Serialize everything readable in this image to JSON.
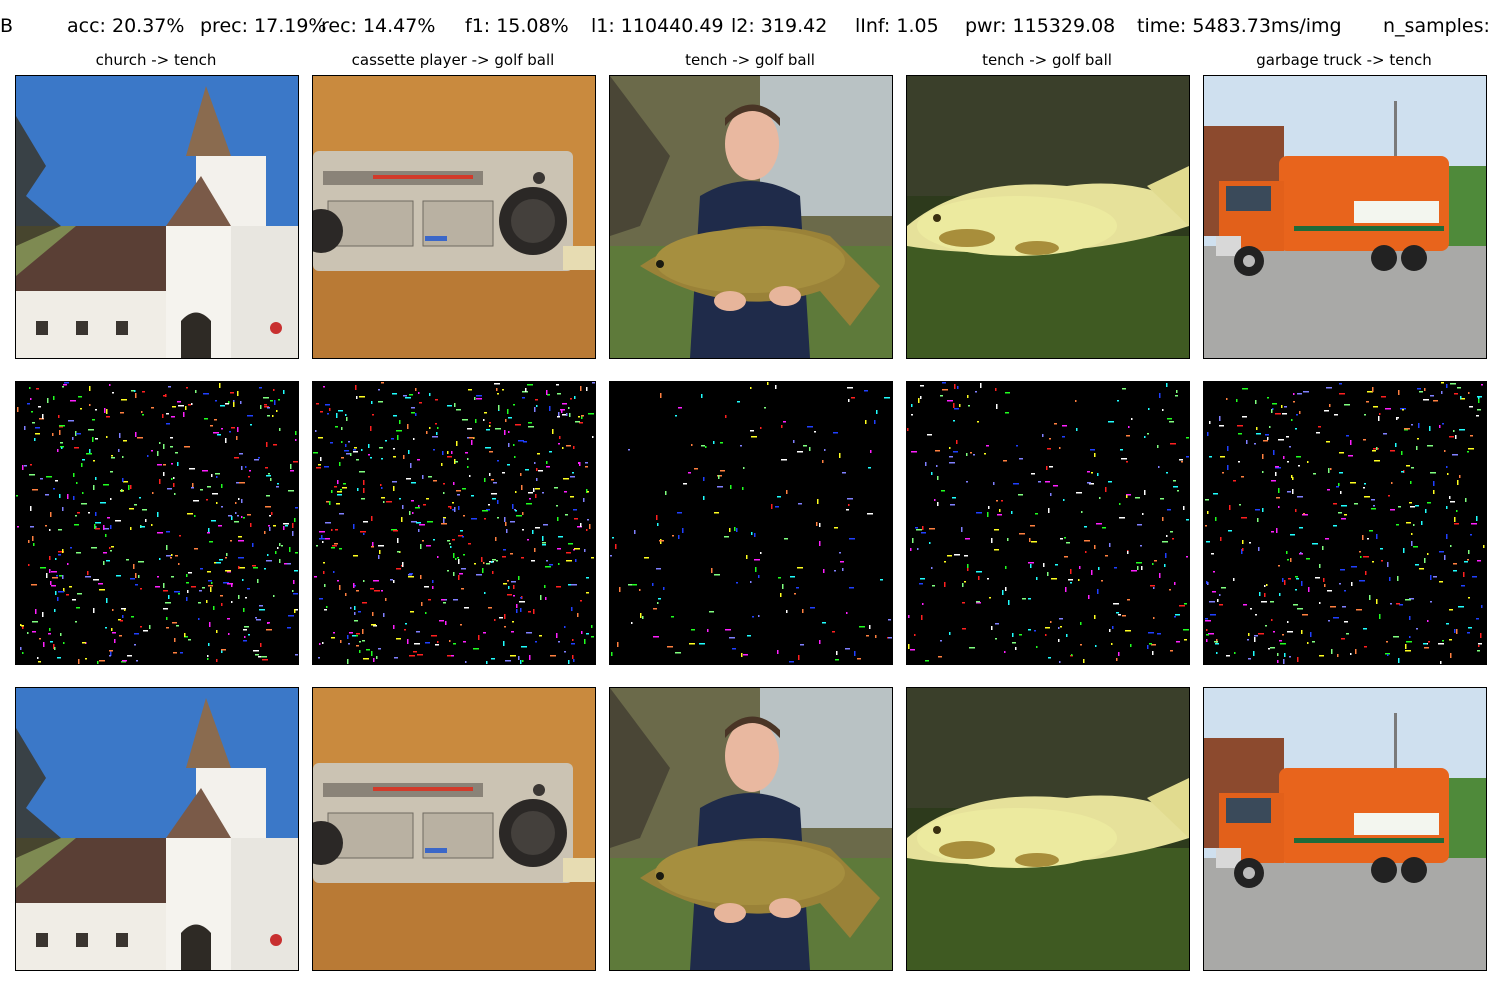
{
  "header": {
    "b_label": "B",
    "acc": "acc: 20.37%",
    "prec": "prec: 17.19%",
    "rec": "rec: 14.47%",
    "f1": "f1: 15.08%",
    "l1": "l1: 110440.49",
    "l2": "l2: 319.42",
    "linf": "lInf: 1.05",
    "pwr": "pwr: 115329.08",
    "time": "time: 5483.73ms/img",
    "n_samples": "n_samples:"
  },
  "columns": [
    {
      "title": "church -> tench",
      "subject": "church-building"
    },
    {
      "title": "cassette player -> golf ball",
      "subject": "cassette-player"
    },
    {
      "title": "tench -> golf ball",
      "subject": "person-holding-tench"
    },
    {
      "title": "tench -> golf ball",
      "subject": "tench-on-net"
    },
    {
      "title": "garbage truck -> tench",
      "subject": "garbage-truck"
    }
  ],
  "rows": [
    "original-image",
    "perturbation-noise",
    "adversarial-image"
  ],
  "colors": {
    "noise_background": "#000000",
    "panel_border": "#000000"
  }
}
